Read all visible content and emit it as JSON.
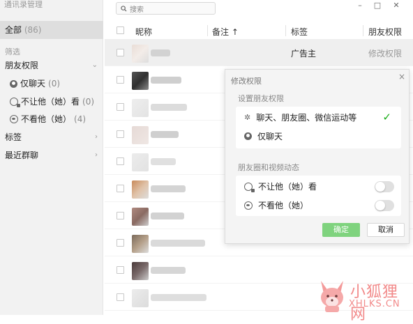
{
  "app": {
    "title": "通讯录管理"
  },
  "sidebar": {
    "all": {
      "label": "全部",
      "count": "(86)"
    },
    "filter_header": "筛选",
    "friend_perm": "朋友权限",
    "perm_items": [
      {
        "label": "仅聊天",
        "count": "(0)"
      },
      {
        "label": "不让他（她）看",
        "count": "(0)"
      },
      {
        "label": "不看他（她）",
        "count": "(4)"
      }
    ],
    "tags": "标签",
    "recent_groups": "最近群聊"
  },
  "search": {
    "placeholder": "搜索"
  },
  "table": {
    "headers": {
      "nickname": "昵称",
      "remark": "备注 ↑",
      "tag": "标签",
      "perm": "朋友权限"
    },
    "first_row": {
      "tag": "广告主",
      "perm": "修改权限"
    }
  },
  "popup": {
    "title": "修改权限",
    "section1": "设置朋友权限",
    "opt_all": "聊天、朋友圈、微信运动等",
    "opt_chat": "仅聊天",
    "section2": "朋友圈和视频动态",
    "toggle1": "不让他（她）看",
    "toggle2": "不看他（她）",
    "ok": "确定",
    "cancel": "取消"
  },
  "watermark": {
    "text": "小狐狸网",
    "url": "XHLKS.CN"
  },
  "colors": {
    "accent_green": "#1aad19",
    "ok_button": "#7fd37e",
    "watermark": "#f28a8a"
  }
}
